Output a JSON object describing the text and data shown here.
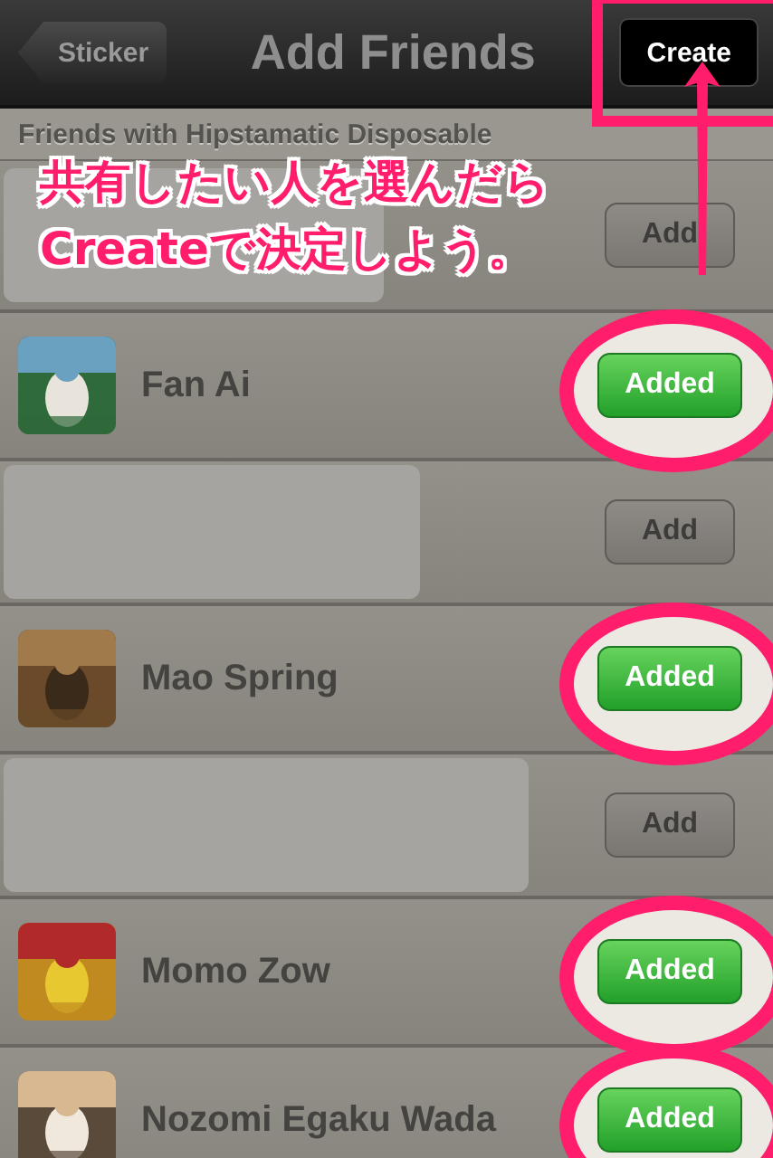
{
  "nav_bar": {
    "back_button": "Sticker",
    "title": "Add Friends",
    "action_button": "Create"
  },
  "section_header": "Friends with Hipstamatic Disposable",
  "rows": [
    {
      "kind": "redacted",
      "button": "Add",
      "added": false
    },
    {
      "kind": "friend",
      "name": "Fan  Ai",
      "button": "Added",
      "added": true,
      "highlighted": true
    },
    {
      "kind": "redacted",
      "button": "Add",
      "added": false
    },
    {
      "kind": "friend",
      "name": "Mao Spring",
      "button": "Added",
      "added": true,
      "highlighted": true
    },
    {
      "kind": "redacted",
      "button": "Add",
      "added": false
    },
    {
      "kind": "friend",
      "name": "Momo  Zow",
      "button": "Added",
      "added": true,
      "highlighted": true
    },
    {
      "kind": "friend",
      "name": "Nozomi Egaku Wada",
      "button": "Added",
      "added": true,
      "highlighted": true
    }
  ],
  "annotation": {
    "lines": [
      "共有したい人を選んだら",
      "Createで決定しよう。"
    ],
    "highlight_action": true
  }
}
